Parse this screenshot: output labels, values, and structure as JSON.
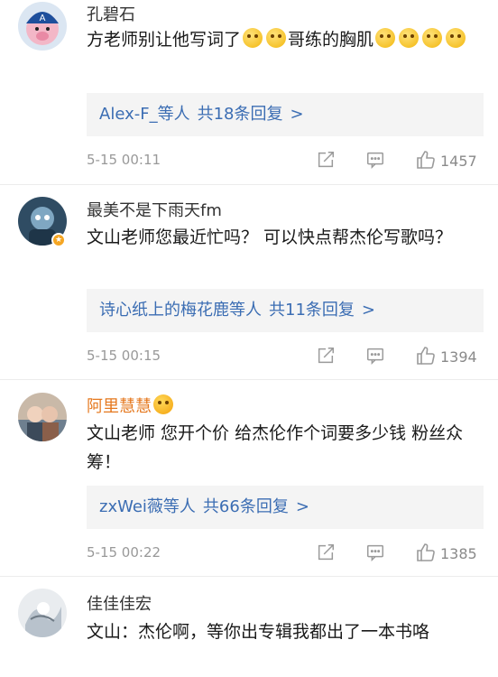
{
  "comments": [
    {
      "username": "孔碧石",
      "text_before": "方老师别让他写词了",
      "text_middle": "哥练的胸肌",
      "reply_names": "Alex-F_等人",
      "reply_count": "共18条回复",
      "time": "5-15 00:11",
      "likes": "1457"
    },
    {
      "username": "最美不是下雨天fm",
      "text": "文山老师您最近忙吗？ 可以快点帮杰伦写歌吗？",
      "reply_names": "诗心纸上的梅花鹿等人",
      "reply_count": "共11条回复",
      "time": "5-15 00:15",
      "likes": "1394"
    },
    {
      "username": "阿里慧慧",
      "text": "文山老师 您开个价 给杰伦作个词要多少钱 粉丝众筹！",
      "reply_names": "zxWei薇等人",
      "reply_count": "共66条回复",
      "time": "5-15 00:22",
      "likes": "1385"
    },
    {
      "username": "佳佳佳宏",
      "text": "文山：杰伦啊，等你出专辑我都出了一本书咯"
    }
  ],
  "ui": {
    "chevron": ">",
    "badge_glyph": "★",
    "vip_color": "#e5781e",
    "link_color": "#3b6db3",
    "icons": [
      "share-icon",
      "comment-icon",
      "thumbs-up-icon",
      "laugh-cry-emoji"
    ]
  }
}
